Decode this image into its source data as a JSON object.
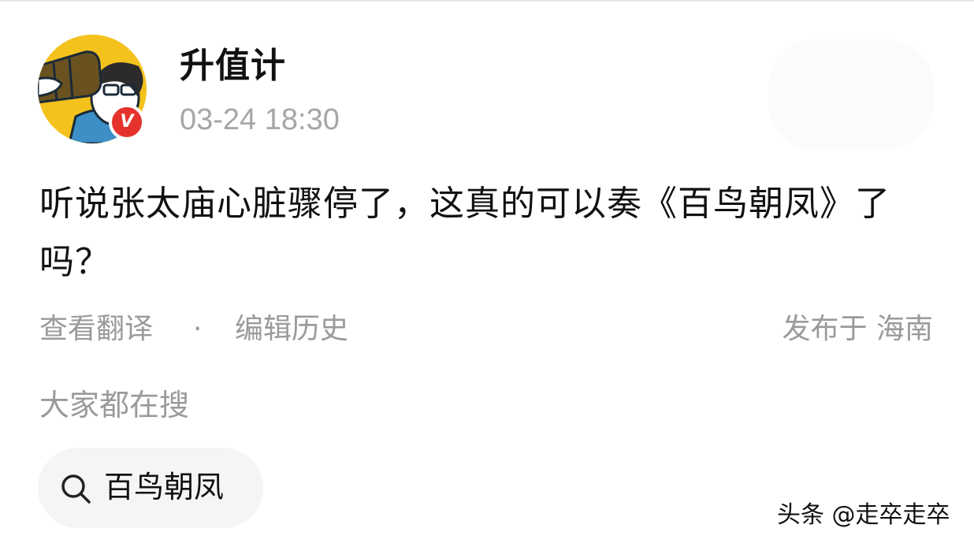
{
  "header": {
    "username": "升值计",
    "timestamp": "03-24 18:30",
    "verified_mark": "V",
    "avatar_icon": "cartoon-avatar-icon"
  },
  "post": {
    "text": "听说张太庙心脏骤停了，这真的可以奏《百鸟朝凤》了吗？"
  },
  "meta": {
    "translate": "查看翻译",
    "separator": "·",
    "edit_history": "编辑历史",
    "location": "发布于 海南"
  },
  "search": {
    "heading": "大家都在搜",
    "chip_label": "百鸟朝凤",
    "chip_icon": "search-icon"
  },
  "watermark": {
    "text": "头条 @走卒走卒"
  },
  "colors": {
    "badge": "#e5322d",
    "avatar_bg": "#f4c21d",
    "muted_text": "#9a9a9a"
  }
}
